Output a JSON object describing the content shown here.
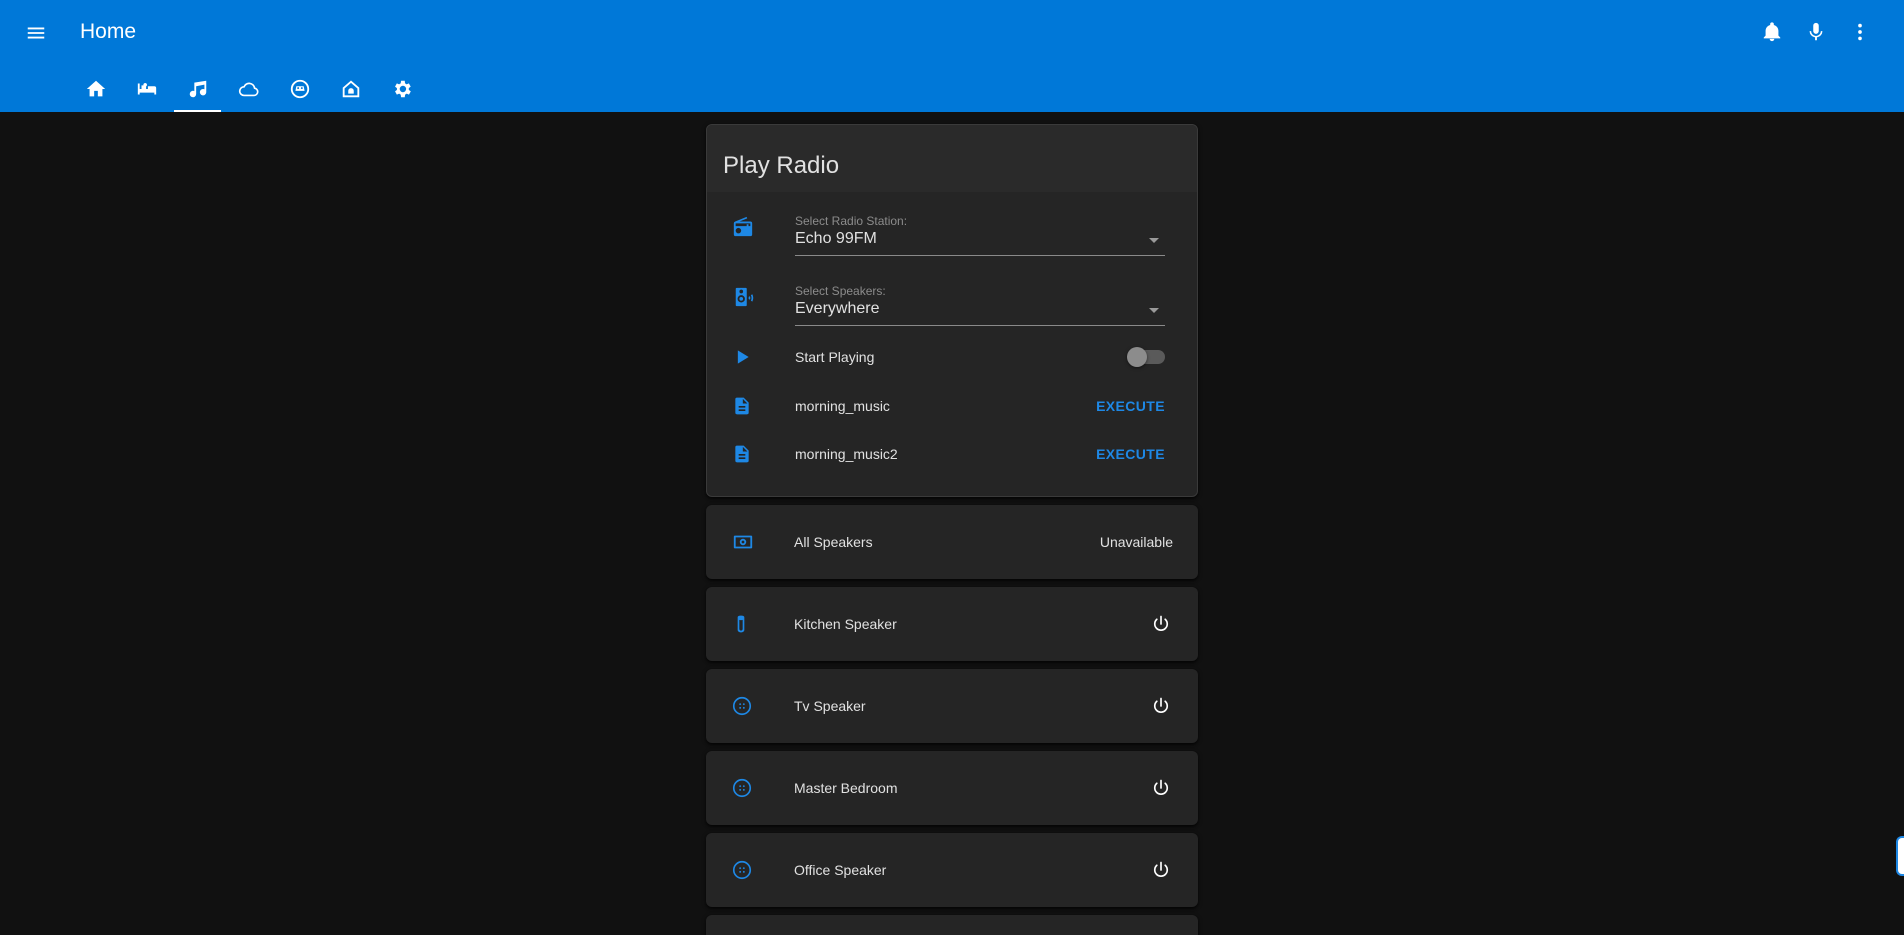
{
  "app": {
    "title": "Home"
  },
  "toolbar": {
    "actions": [
      "bell-icon",
      "microphone-icon",
      "more-vertical-icon"
    ]
  },
  "tabs": [
    {
      "icon": "home-icon",
      "active": false
    },
    {
      "icon": "bed-icon",
      "active": false
    },
    {
      "icon": "music-icon",
      "active": true
    },
    {
      "icon": "cloud-icon",
      "active": false
    },
    {
      "icon": "robot-vacuum-icon",
      "active": false
    },
    {
      "icon": "home-alarm-icon",
      "active": false
    },
    {
      "icon": "settings-icon",
      "active": false
    }
  ],
  "play_radio": {
    "title": "Play Radio",
    "station": {
      "label": "Select Radio Station:",
      "value": "Echo 99FM",
      "icon": "radio-icon"
    },
    "speakers": {
      "label": "Select Speakers:",
      "value": "Everywhere",
      "icon": "speaker-wireless-icon"
    },
    "start": {
      "label": "Start Playing",
      "icon": "play-icon",
      "on": false
    },
    "scripts": [
      {
        "name": "morning_music",
        "action": "EXECUTE",
        "icon": "script-icon"
      },
      {
        "name": "morning_music2",
        "action": "EXECUTE",
        "icon": "script-icon"
      }
    ]
  },
  "entities": {
    "all_speakers": {
      "name": "All Speakers",
      "state": "Unavailable",
      "icon": "speaker-group-icon"
    },
    "kitchen": {
      "name": "Kitchen Speaker",
      "icon": "smart-speaker-icon"
    },
    "tv": {
      "name": "Tv Speaker",
      "icon": "google-home-icon"
    },
    "master_bedroom": {
      "name": "Master Bedroom",
      "icon": "google-home-icon"
    },
    "office": {
      "name": "Office Speaker",
      "icon": "google-home-icon"
    }
  },
  "colors": {
    "header": "#0078d8",
    "accent": "#1e88e5",
    "background": "#111111",
    "card": "#252525"
  }
}
